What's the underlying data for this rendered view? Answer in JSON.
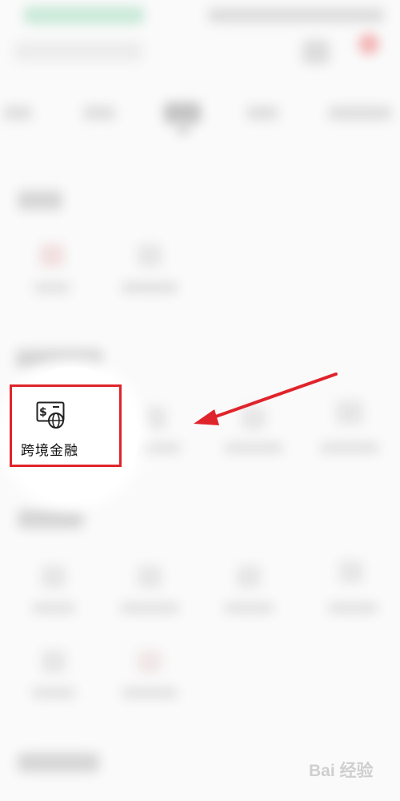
{
  "screen": {
    "background": "#fafafa",
    "blur_note_free": true
  },
  "highlight": {
    "item_label": "跨境金融",
    "item_icon": "card-globe-icon",
    "box_color": "#e0242b",
    "arrow_color": "#e0242b"
  },
  "watermark": {
    "text": "Bai 经验"
  }
}
